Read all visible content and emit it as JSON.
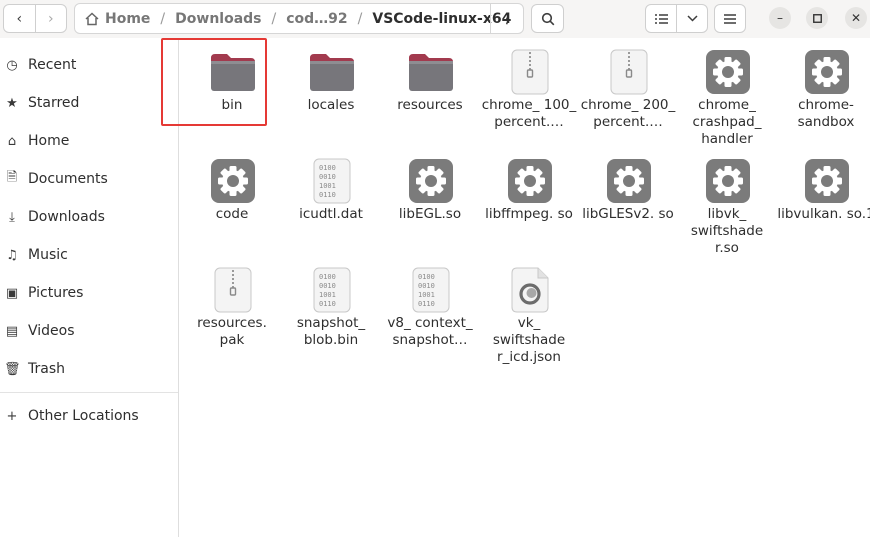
{
  "header": {
    "breadcrumbs": [
      "Home",
      "Downloads",
      "cod…92",
      "VSCode-linux-x64"
    ],
    "separator": "/",
    "back_icon": "back-arrow-icon",
    "forward_icon": "forward-arrow-icon",
    "path_menu_icon": "vertical-dots-icon",
    "search_icon": "search-icon",
    "view_icon": "list-view-icon",
    "view_dropdown_icon": "chevron-down-icon",
    "menu_icon": "hamburger-icon",
    "window_buttons": [
      "minimize",
      "maximize",
      "close"
    ]
  },
  "sidebar": {
    "items": [
      {
        "label": "Recent",
        "icon": "clock-icon"
      },
      {
        "label": "Starred",
        "icon": "star-icon"
      },
      {
        "label": "Home",
        "icon": "home-icon"
      },
      {
        "label": "Documents",
        "icon": "document-icon"
      },
      {
        "label": "Downloads",
        "icon": "download-icon"
      },
      {
        "label": "Music",
        "icon": "music-icon"
      },
      {
        "label": "Pictures",
        "icon": "picture-icon"
      },
      {
        "label": "Videos",
        "icon": "video-icon"
      },
      {
        "label": "Trash",
        "icon": "trash-icon"
      }
    ],
    "other_locations": {
      "label": "Other Locations",
      "icon": "plus-icon"
    }
  },
  "files": [
    {
      "name": "bin",
      "type": "folder",
      "selected": true
    },
    {
      "name": "locales",
      "type": "folder"
    },
    {
      "name": "resources",
      "type": "folder"
    },
    {
      "name": "chrome_ 100_ percent.…",
      "type": "archive"
    },
    {
      "name": "chrome_ 200_ percent.…",
      "type": "archive"
    },
    {
      "name": "chrome_ crashpad_ handler",
      "type": "executable"
    },
    {
      "name": "chrome- sandbox",
      "type": "executable"
    },
    {
      "name": "code",
      "type": "executable"
    },
    {
      "name": "icudtl.dat",
      "type": "binary"
    },
    {
      "name": "libEGL.so",
      "type": "executable"
    },
    {
      "name": "libffmpeg. so",
      "type": "executable"
    },
    {
      "name": "libGLESv2. so",
      "type": "executable"
    },
    {
      "name": "libvk_ swiftshade r.so",
      "type": "executable"
    },
    {
      "name": "libvulkan. so.1",
      "type": "executable"
    },
    {
      "name": "resources. pak",
      "type": "archive"
    },
    {
      "name": "snapshot_ blob.bin",
      "type": "binary"
    },
    {
      "name": "v8_ context_ snapshot…",
      "type": "binary"
    },
    {
      "name": "vk_ swiftshade r_icd.json",
      "type": "json"
    }
  ],
  "colors": {
    "folder": "#77767b",
    "folder_tab": "#a23a4e",
    "selection_outline": "#e53935"
  }
}
